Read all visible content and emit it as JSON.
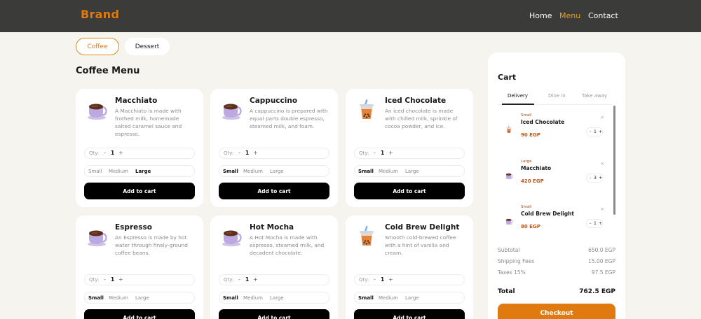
{
  "header": {
    "brand": "Brand",
    "nav": [
      "Home",
      "Menu",
      "Contact"
    ],
    "active_nav": "Menu",
    "colors": {
      "bar": "#3b3b39",
      "brand": "#e07a0f",
      "active": "#e8a020"
    }
  },
  "categories": [
    "Coffee",
    "Dessert"
  ],
  "menu": {
    "title": "Coffee Menu",
    "qty_label": "Qty:",
    "minus": "-",
    "plus": "+",
    "sizes": [
      "Small",
      "Medium",
      "Large"
    ],
    "add_label": "Add to cart",
    "items": [
      {
        "name": "Macchiato",
        "desc": "A Macchiato is made with frothed milk, homemade salted caramel sauce and espresso.",
        "qty": "1",
        "selected_size": "Large",
        "icon": "hot-cup-icon"
      },
      {
        "name": "Cappuccino",
        "desc": "A cappuccino is prepared with equal parts double espresso, steamed milk, and foam.",
        "qty": "1",
        "selected_size": "Small",
        "icon": "hot-cup-icon"
      },
      {
        "name": "Iced Chocolate",
        "desc": "An iced chocolate is made with chilled milk, sprinkle of cocoa powder, and ice.",
        "qty": "1",
        "selected_size": "Small",
        "icon": "iced-drink-icon"
      },
      {
        "name": "Espresso",
        "desc": "An Espresso is made by hot water through finely-ground coffee beans.",
        "qty": "1",
        "selected_size": "Small",
        "icon": "hot-cup-icon"
      },
      {
        "name": "Hot Mocha",
        "desc": "A Hot Mocha is made with espresso, steamed milk, and decadent chocolate.",
        "qty": "1",
        "selected_size": "Small",
        "icon": "hot-cup-icon"
      },
      {
        "name": "Cold Brew Delight",
        "desc": "Smooth cold-brewed coffee with a hint of vanilla and cream.",
        "qty": "1",
        "selected_size": "Small",
        "icon": "iced-drink-icon"
      }
    ]
  },
  "cart": {
    "title": "Cart",
    "tabs": [
      "Delivery",
      "Dine in",
      "Take away"
    ],
    "active_tab": "Delivery",
    "remove": "×",
    "items": [
      {
        "size": "Small",
        "name": "Iced Chocolate",
        "price": "90 EGP",
        "qty": "1",
        "icon": "iced-drink-icon"
      },
      {
        "size": "Large",
        "name": "Macchiato",
        "price": "420 EGP",
        "qty": "3",
        "icon": "hot-cup-icon"
      },
      {
        "size": "Small",
        "name": "Cold Brew Delight",
        "price": "80 EGP",
        "qty": "1",
        "icon": "hot-cup-icon"
      }
    ],
    "subtotal_label": "Subtotal",
    "subtotal": "650.0 EGP",
    "shipping_label": "Shipping Fees",
    "shipping": "15.00 EGP",
    "taxes_label": "Taxes 15%",
    "taxes": "97.5 EGP",
    "total_label": "Total",
    "total": "762.5 EGP",
    "checkout_label": "Checkout"
  }
}
